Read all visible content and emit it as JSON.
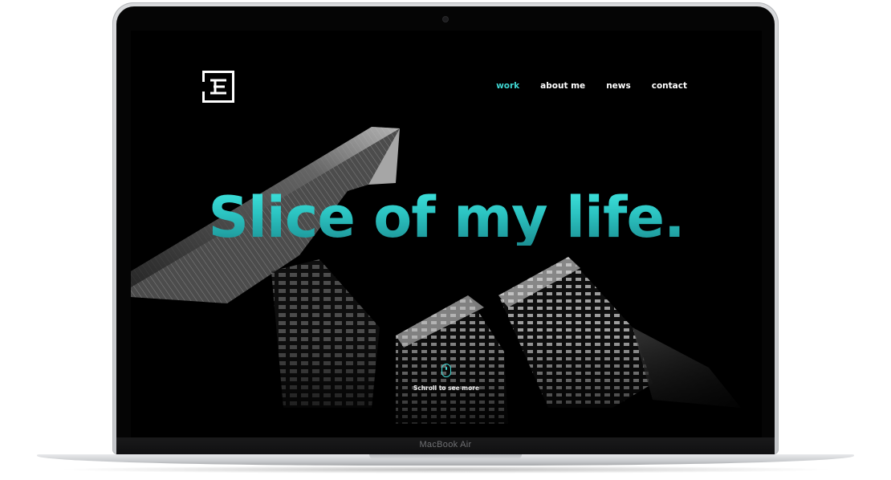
{
  "device": {
    "label": "MacBook Air"
  },
  "site": {
    "logo_icon": "stylized-e-logo",
    "nav": [
      {
        "label": "work",
        "active": true
      },
      {
        "label": "about me",
        "active": false
      },
      {
        "label": "news",
        "active": false
      },
      {
        "label": "contact",
        "active": false
      }
    ],
    "headline": "Slice of my life.",
    "scroll_hint": {
      "icon": "mouse-icon",
      "label": "Schroll to see more"
    }
  },
  "colors": {
    "accent": "#3fd6d2",
    "background": "#000000",
    "nav_text": "#ffffff"
  }
}
